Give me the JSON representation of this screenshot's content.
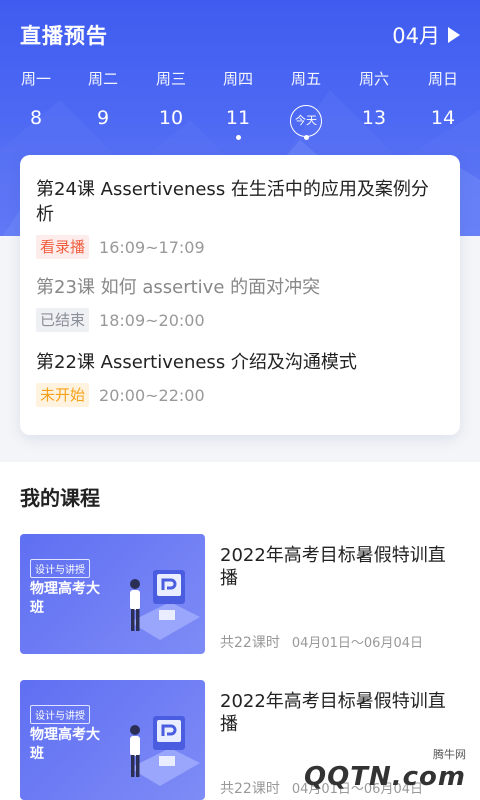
{
  "header": {
    "title": "直播预告",
    "month": "04月"
  },
  "week": [
    {
      "wd": "周一",
      "num": "8"
    },
    {
      "wd": "周二",
      "num": "9"
    },
    {
      "wd": "周三",
      "num": "10"
    },
    {
      "wd": "周四",
      "num": "11"
    },
    {
      "wd": "周五",
      "num": "今天"
    },
    {
      "wd": "周六",
      "num": "13"
    },
    {
      "wd": "周日",
      "num": "14"
    }
  ],
  "lessons": [
    {
      "title": "第24课 Assertiveness 在生活中的应用及案例分析",
      "status": "看录播",
      "time": "16:09~17:09"
    },
    {
      "title": "第23课 如何 assertive 的面对冲突",
      "status": "已结束",
      "time": "18:09~20:00"
    },
    {
      "title": "第22课 Assertiveness 介绍及沟通模式",
      "status": "未开始",
      "time": "20:00~22:00"
    }
  ],
  "my_courses": {
    "title": "我的课程",
    "items": [
      {
        "tag": "设计与讲授",
        "subject": "物理高考大班",
        "title": "2022年高考目标暑假特训直播",
        "hours": "共22课时",
        "dates": "04月01日～06月04日"
      },
      {
        "tag": "设计与讲授",
        "subject": "物理高考大班",
        "title": "2022年高考目标暑假特训直播",
        "hours": "共22课时",
        "dates": "04月01日～06月04日"
      }
    ]
  },
  "watermark": {
    "line1": "腾牛网",
    "line2": "QQTN.com"
  }
}
